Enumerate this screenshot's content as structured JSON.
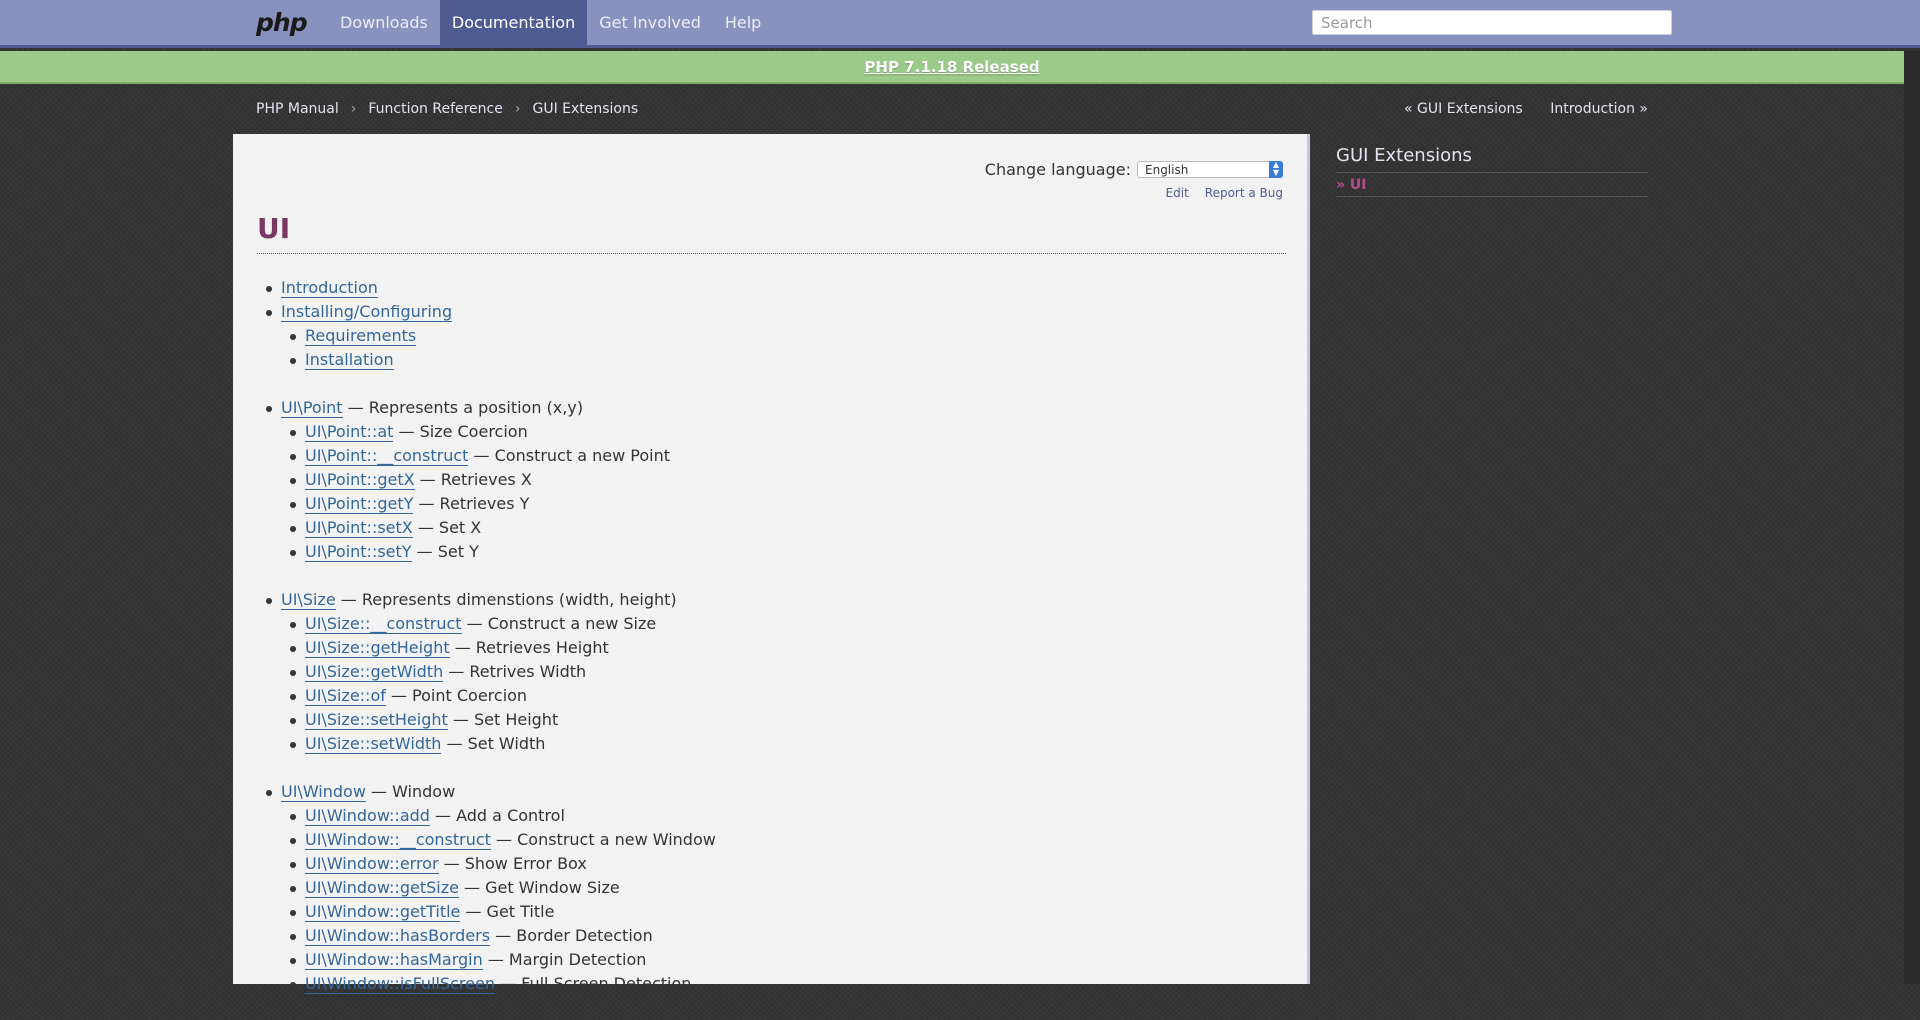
{
  "header": {
    "logo": "php",
    "nav": [
      "Downloads",
      "Documentation",
      "Get Involved",
      "Help"
    ],
    "active_nav": "Documentation",
    "search_placeholder": "Search"
  },
  "banner": {
    "text": "PHP 7.1.18 Released"
  },
  "breadcrumb": [
    "PHP Manual",
    "Function Reference",
    "GUI Extensions"
  ],
  "prevnext": {
    "prev": "« GUI Extensions",
    "next": "Introduction »"
  },
  "lang": {
    "label": "Change language:",
    "selected": "English"
  },
  "edit_links": {
    "edit": "Edit",
    "report": "Report a Bug"
  },
  "title": "UI",
  "toc": {
    "intro": [
      {
        "link": "Introduction",
        "desc": ""
      },
      {
        "link": "Installing/Configuring",
        "desc": "",
        "children": [
          {
            "link": "Requirements",
            "desc": ""
          },
          {
            "link": "Installation",
            "desc": ""
          }
        ]
      }
    ],
    "groups": [
      {
        "link": "UI\\Point",
        "desc": " — Represents a position (x,y)",
        "children": [
          {
            "link": "UI\\Point::at",
            "desc": " — Size Coercion"
          },
          {
            "link": "UI\\Point::__construct",
            "desc": " — Construct a new Point"
          },
          {
            "link": "UI\\Point::getX",
            "desc": " — Retrieves X"
          },
          {
            "link": "UI\\Point::getY",
            "desc": " — Retrieves Y"
          },
          {
            "link": "UI\\Point::setX",
            "desc": " — Set X"
          },
          {
            "link": "UI\\Point::setY",
            "desc": " — Set Y"
          }
        ]
      },
      {
        "link": "UI\\Size",
        "desc": " — Represents dimenstions (width, height)",
        "children": [
          {
            "link": "UI\\Size::__construct",
            "desc": " — Construct a new Size"
          },
          {
            "link": "UI\\Size::getHeight",
            "desc": " — Retrieves Height"
          },
          {
            "link": "UI\\Size::getWidth",
            "desc": " — Retrives Width"
          },
          {
            "link": "UI\\Size::of",
            "desc": " — Point Coercion"
          },
          {
            "link": "UI\\Size::setHeight",
            "desc": " — Set Height"
          },
          {
            "link": "UI\\Size::setWidth",
            "desc": " — Set Width"
          }
        ]
      },
      {
        "link": "UI\\Window",
        "desc": " — Window",
        "children": [
          {
            "link": "UI\\Window::add",
            "desc": " — Add a Control"
          },
          {
            "link": "UI\\Window::__construct",
            "desc": " — Construct a new Window"
          },
          {
            "link": "UI\\Window::error",
            "desc": " — Show Error Box"
          },
          {
            "link": "UI\\Window::getSize",
            "desc": " — Get Window Size"
          },
          {
            "link": "UI\\Window::getTitle",
            "desc": " — Get Title"
          },
          {
            "link": "UI\\Window::hasBorders",
            "desc": " — Border Detection"
          },
          {
            "link": "UI\\Window::hasMargin",
            "desc": " — Margin Detection"
          },
          {
            "link": "UI\\Window::isFullScreen",
            "desc": " — Full Screen Detection"
          }
        ]
      }
    ]
  },
  "sidebar": {
    "title": "GUI Extensions",
    "items": [
      "» UI"
    ]
  },
  "colors": {
    "topbar": "#8892bf",
    "active_nav": "#4f5b93",
    "banner": "#9cca8a",
    "title": "#793862",
    "link": "#336699"
  }
}
